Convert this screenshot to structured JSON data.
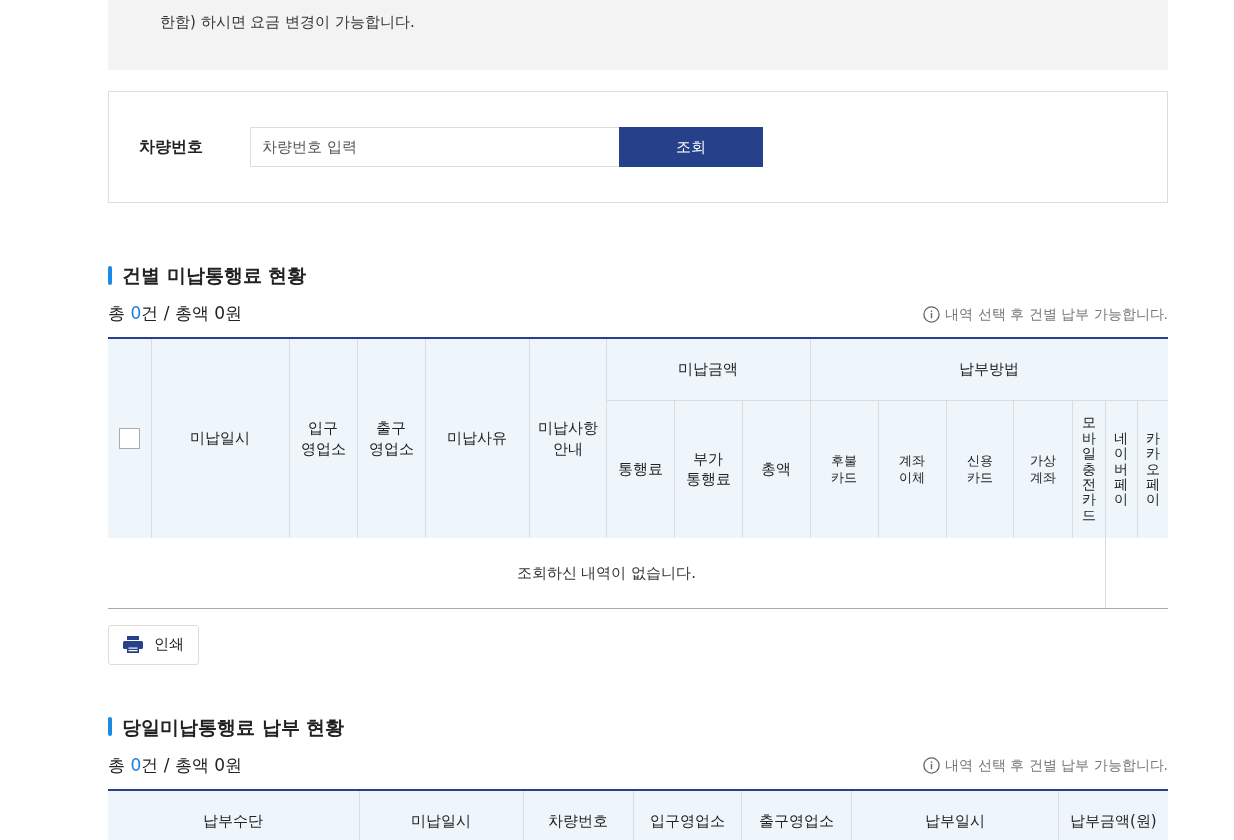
{
  "notice": {
    "text": "한함) 하시면 요금 변경이 가능합니다."
  },
  "search": {
    "label": "차량번호",
    "placeholder": "차량번호 입력",
    "button": "조회"
  },
  "sections": [
    {
      "title": "건별 미납통행료 현황",
      "summary": {
        "before": "총 ",
        "count": "0",
        "after": "건 / 총액 0원"
      },
      "hint": "내역 선택 후 건별 납부 가능합니다.",
      "table": {
        "columns": [
          {
            "kind": "checkbox",
            "checked": false
          },
          {
            "kind": "text",
            "label": "미납일시"
          },
          {
            "kind": "text",
            "label": "입구\n영업소"
          },
          {
            "kind": "text",
            "label": "출구\n영업소"
          },
          {
            "kind": "text",
            "label": "미납사유"
          },
          {
            "kind": "text",
            "label": "미납사항\n안내"
          },
          {
            "kind": "group",
            "label": "미납금액",
            "children": [
              {
                "kind": "text",
                "label": "통행료"
              },
              {
                "kind": "text",
                "label": "부가\n통행료"
              },
              {
                "kind": "text",
                "label": "총액"
              }
            ]
          },
          {
            "kind": "group",
            "label": "납부방법",
            "children": [
              {
                "kind": "small",
                "label": "후불\n카드"
              },
              {
                "kind": "small",
                "label": "계좌\n이체"
              },
              {
                "kind": "small",
                "label": "신용\n카드"
              },
              {
                "kind": "small",
                "label": "가상\n계좌"
              },
              {
                "kind": "vertical",
                "label": "모바일충전카드"
              },
              {
                "kind": "vertical",
                "label": "네이버페이"
              },
              {
                "kind": "vertical",
                "label": "카카오페이"
              }
            ]
          }
        ],
        "empty_text": "조회하신 내역이 없습니다."
      },
      "print_button": "인쇄"
    },
    {
      "title": "당일미납통행료 납부 현황",
      "summary": {
        "before": "총 ",
        "count": "0",
        "after": "건 / 총액 0원"
      },
      "hint": "내역 선택 후 건별 납부 가능합니다.",
      "table": {
        "columns": [
          {
            "kind": "text",
            "label": "납부수단"
          },
          {
            "kind": "text",
            "label": "미납일시"
          },
          {
            "kind": "text",
            "label": "차량번호"
          },
          {
            "kind": "text",
            "label": "입구영업소"
          },
          {
            "kind": "text",
            "label": "출구영업소"
          },
          {
            "kind": "text",
            "label": "납부일시"
          },
          {
            "kind": "text",
            "label": "납부금액(원)"
          }
        ]
      }
    }
  ]
}
